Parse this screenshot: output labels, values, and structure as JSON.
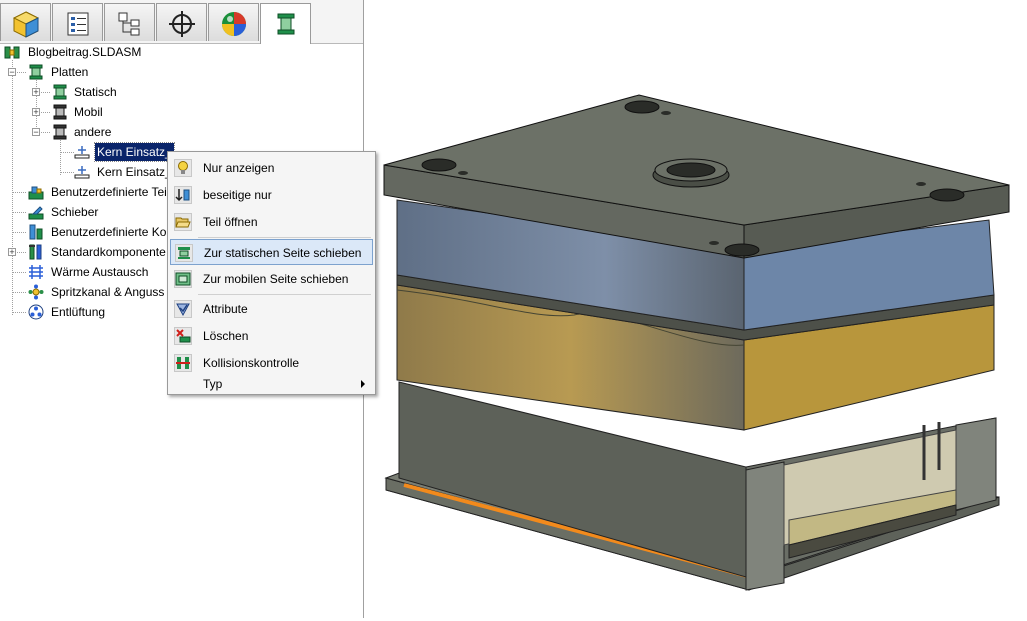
{
  "tabs": [
    {
      "name": "feature-manager-icon"
    },
    {
      "name": "property-manager-icon"
    },
    {
      "name": "configuration-manager-icon"
    },
    {
      "name": "dimxpert-icon"
    },
    {
      "name": "display-manager-icon"
    },
    {
      "name": "mold-base-icon",
      "active": true
    }
  ],
  "tree": {
    "root": "Blogbeitrag.SLDASM",
    "platten": "Platten",
    "statisch": "Statisch",
    "mobil": "Mobil",
    "andere": "andere",
    "kern1": "Kern Einsatz_",
    "kern2": "Kern Einsatz_",
    "benutzer_teile": "Benutzerdefinierte Tei",
    "schieber": "Schieber",
    "benutzer_kom": "Benutzerdefinierte Kon",
    "standard": "Standardkomponente",
    "waerme": "Wärme Austausch",
    "spritz": "Spritzkanal & Anguss",
    "entlueftung": "Entlüftung"
  },
  "menu": {
    "nur_anzeigen": "Nur anzeigen",
    "beseitige_nur": "beseitige nur",
    "teil_oeffnen": "Teil öffnen",
    "zur_statischen": "Zur statischen Seite schieben",
    "zur_mobilen": "Zur mobilen Seite schieben",
    "attribute": "Attribute",
    "loeschen": "Löschen",
    "kollision": "Kollisionskontrolle",
    "typ": "Typ"
  },
  "colors": {
    "selection": "#0a246a",
    "menu_highlight": "#dbe8f8",
    "plate_top": "#6c7167",
    "plate_side": "#5a5e56",
    "accent_orange": "#f28a1c",
    "cavity_gold": "#c9a14a",
    "cavity_blue": "#6d86a8"
  }
}
